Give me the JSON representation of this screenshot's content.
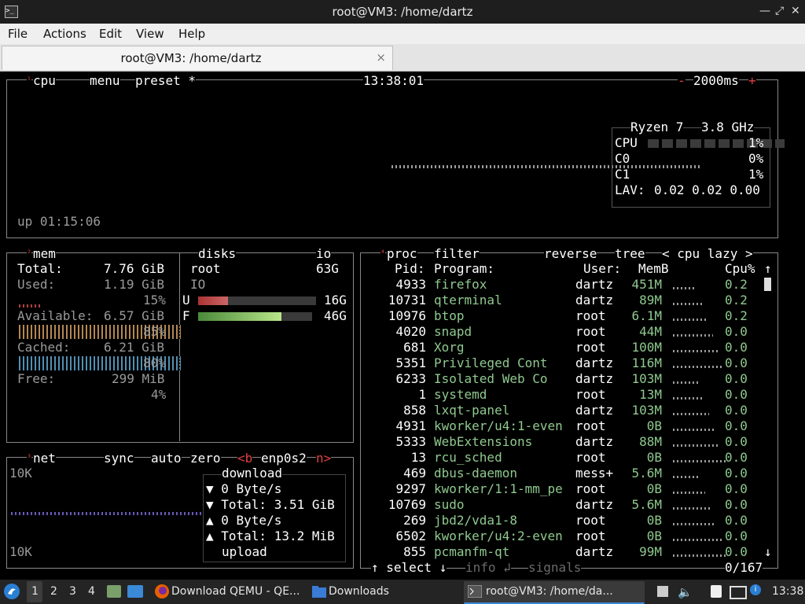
{
  "window": {
    "title": "root@VM3: /home/dartz"
  },
  "menu": [
    "File",
    "Actions",
    "Edit",
    "View",
    "Help"
  ],
  "tab": {
    "label": "root@VM3: /home/dartz",
    "close": "×"
  },
  "cpu_panel": {
    "title": "cpu",
    "menu": "menu",
    "preset": "preset *",
    "time": "13:38:01",
    "interval": "2000ms",
    "minus": "-",
    "plus": "+",
    "uptime": "up 01:15:06",
    "model": "Ryzen 7",
    "freq": "3.8 GHz",
    "cpu_label": "CPU",
    "cpu_pct": "1%",
    "c0_label": "C0",
    "c0_pct": "0%",
    "c1_label": "C1",
    "c1_pct": "1%",
    "lav_label": "LAV:",
    "lav": "0.02 0.02 0.00"
  },
  "mem_panel": {
    "title": "mem",
    "total_label": "Total:",
    "total": "7.76 GiB",
    "used_label": "Used:",
    "used": "1.19 GiB",
    "used_pct": "15%",
    "avail_label": "Available:",
    "avail": "6.57 GiB",
    "avail_pct": "85%",
    "cached_label": "Cached:",
    "cached": "6.21 GiB",
    "cached_pct": "80%",
    "free_label": "Free:",
    "free": "299 MiB",
    "free_pct": "4%"
  },
  "disks_panel": {
    "title": "disks",
    "io": "io",
    "name": "root",
    "size": "63G",
    "io_label": "IO",
    "u_label": "U",
    "u_val": "16G",
    "u_fraction": 0.25,
    "f_label": "F",
    "f_val": "46G",
    "f_fraction": 0.73
  },
  "net_panel": {
    "title": "net",
    "sync": "sync",
    "auto": "auto",
    "zero": "zero",
    "b": "<b",
    "iface": "enp0s2",
    "n": "n>",
    "scale_top": "10K",
    "scale_bottom": "10K",
    "download": "download",
    "dl_rate": "▼ 0 Byte/s",
    "dl_total": "▼ Total: 3.51 GiB",
    "ul_rate": "▲ 0 Byte/s",
    "ul_total": "▲ Total: 13.2 MiB",
    "upload": "upload"
  },
  "proc_panel": {
    "title": "proc",
    "filter": "filter",
    "reverse": "reverse",
    "tree": "tree",
    "sort": "< cpu lazy >",
    "headers": {
      "pid": "Pid:",
      "program": "Program:",
      "user": "User:",
      "mem": "MemB",
      "cpu": "Cpu%"
    },
    "rows": [
      {
        "pid": "4933",
        "program": "firefox",
        "user": "dartz",
        "mem": "451M",
        "cpu": "0.2"
      },
      {
        "pid": "10731",
        "program": "qterminal",
        "user": "dartz",
        "mem": "89M",
        "cpu": "0.2"
      },
      {
        "pid": "10976",
        "program": "btop",
        "user": "root",
        "mem": "6.1M",
        "cpu": "0.2"
      },
      {
        "pid": "4020",
        "program": "snapd",
        "user": "root",
        "mem": "44M",
        "cpu": "0.0"
      },
      {
        "pid": "681",
        "program": "Xorg",
        "user": "root",
        "mem": "100M",
        "cpu": "0.0"
      },
      {
        "pid": "5351",
        "program": "Privileged Cont",
        "user": "dartz",
        "mem": "116M",
        "cpu": "0.0"
      },
      {
        "pid": "6233",
        "program": "Isolated Web Co",
        "user": "dartz",
        "mem": "103M",
        "cpu": "0.0"
      },
      {
        "pid": "1",
        "program": "systemd",
        "user": "root",
        "mem": "13M",
        "cpu": "0.0"
      },
      {
        "pid": "858",
        "program": "lxqt-panel",
        "user": "dartz",
        "mem": "103M",
        "cpu": "0.0"
      },
      {
        "pid": "4931",
        "program": "kworker/u4:1-even",
        "user": "root",
        "mem": "0B",
        "cpu": "0.0"
      },
      {
        "pid": "5333",
        "program": "WebExtensions",
        "user": "dartz",
        "mem": "88M",
        "cpu": "0.0"
      },
      {
        "pid": "13",
        "program": "rcu_sched",
        "user": "root",
        "mem": "0B",
        "cpu": "0.0"
      },
      {
        "pid": "469",
        "program": "dbus-daemon",
        "user": "mess+",
        "mem": "5.6M",
        "cpu": "0.0"
      },
      {
        "pid": "9297",
        "program": "kworker/1:1-mm_pe",
        "user": "root",
        "mem": "0B",
        "cpu": "0.0"
      },
      {
        "pid": "10769",
        "program": "sudo",
        "user": "dartz",
        "mem": "5.6M",
        "cpu": "0.0"
      },
      {
        "pid": "269",
        "program": "jbd2/vda1-8",
        "user": "root",
        "mem": "0B",
        "cpu": "0.0"
      },
      {
        "pid": "6502",
        "program": "kworker/u4:2-even",
        "user": "root",
        "mem": "0B",
        "cpu": "0.0"
      },
      {
        "pid": "855",
        "program": "pcmanfm-qt",
        "user": "dartz",
        "mem": "99M",
        "cpu": "0.0"
      }
    ],
    "footer_select": "↑ select ↓",
    "footer_info": "info ↲",
    "footer_signals": "signals",
    "count": "0/167",
    "scroll_up": "↑",
    "scroll_down": "↓"
  },
  "taskbar": {
    "workspaces": [
      "1",
      "2",
      "3",
      "4"
    ],
    "apps": [
      {
        "label": "Download QEMU - QE...",
        "icon": "firefox-icon"
      },
      {
        "label": "Downloads",
        "icon": "folder-icon"
      },
      {
        "label": "root@VM3: /home/da...",
        "icon": "terminal-icon"
      }
    ],
    "clock": "13:38"
  }
}
